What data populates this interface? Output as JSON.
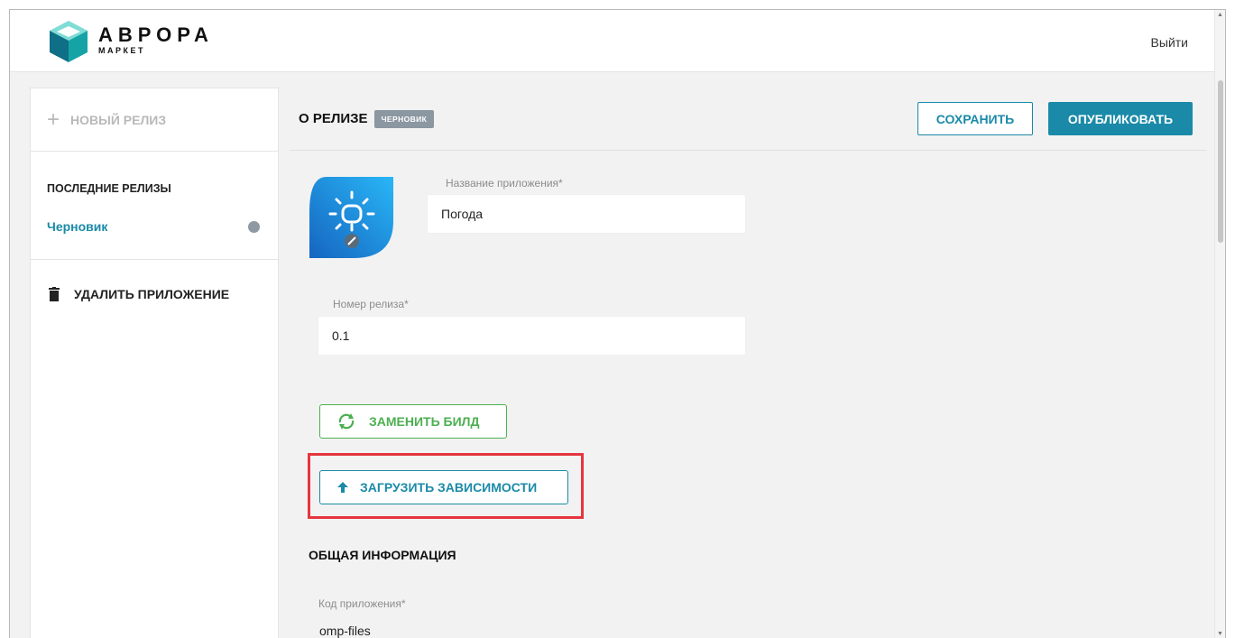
{
  "header": {
    "logo_title": "АВРОРА",
    "logo_subtitle": "МАРКЕТ",
    "logout": "Выйти"
  },
  "sidebar": {
    "new_release": "НОВЫЙ РЕЛИЗ",
    "recent_title": "ПОСЛЕДНИЕ РЕЛИЗЫ",
    "draft_item": "Черновик",
    "delete_app": "УДАЛИТЬ ПРИЛОЖЕНИЕ"
  },
  "main": {
    "title": "О РЕЛИЗЕ",
    "status_badge": "ЧЕРНОВИК",
    "save": "СОХРАНИТЬ",
    "publish": "ОПУБЛИКОВАТЬ",
    "app_name_label": "Название приложения*",
    "app_name_value": "Погода",
    "release_number_label": "Номер релиза*",
    "release_number_value": "0.1",
    "replace_build": "ЗАМЕНИТЬ БИЛД",
    "upload_dependencies": "ЗАГРУЗИТЬ ЗАВИСИМОСТИ",
    "general_info_title": "ОБЩАЯ ИНФОРМАЦИЯ",
    "app_code_label": "Код приложения*",
    "app_code_value": "omp-files"
  },
  "colors": {
    "accent": "#1a8aa8",
    "replace_green": "#4caf50",
    "highlight_red": "#e5353f",
    "badge_gray": "#8b97a1"
  },
  "icons": {
    "logo": "aurora-cube-logo",
    "plus": "plus-icon",
    "trash": "trash-icon",
    "refresh": "refresh-icon",
    "upload": "arrow-up-icon",
    "app_icon": "weather-app-icon",
    "edit": "pencil-icon"
  }
}
